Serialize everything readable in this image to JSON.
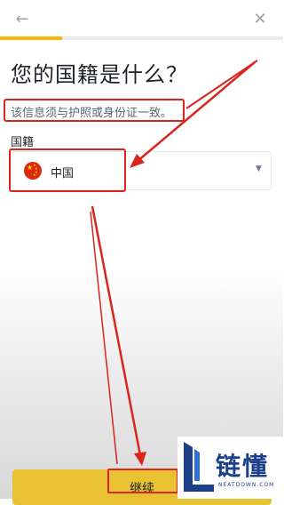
{
  "header": {
    "back_icon": "←",
    "close_icon": "✕"
  },
  "progress": {
    "fraction": 0.22,
    "color": "#f0b90b"
  },
  "title": "您的国籍是什么？",
  "subtitle": "该信息须与护照或身份证一致。",
  "nationality": {
    "label": "国籍",
    "value": "中国",
    "flag_icon": "china-flag",
    "caret": "▼"
  },
  "continue_label": "继续",
  "annotation_color": "#d9261c",
  "watermark": {
    "text": "链懂",
    "sub": "NEATDOWN.COM"
  }
}
